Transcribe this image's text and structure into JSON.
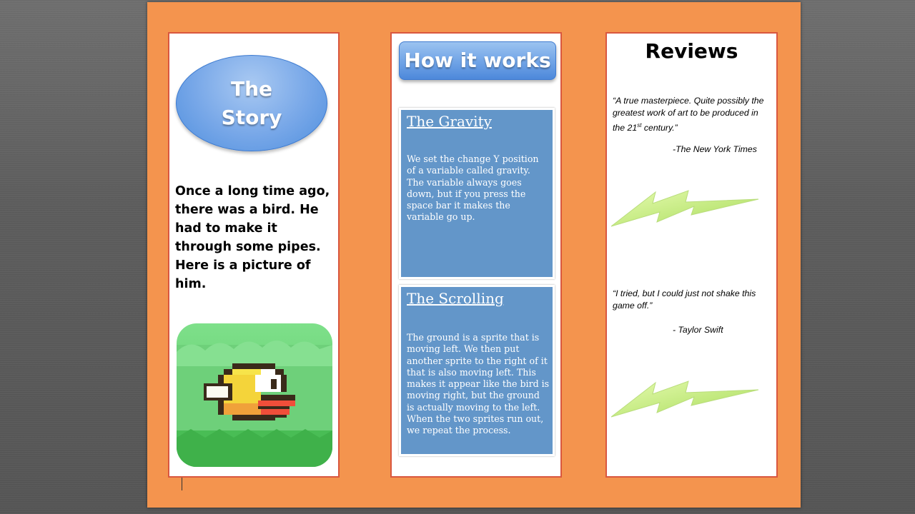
{
  "story": {
    "heading_line1": "The",
    "heading_line2": "Story",
    "text": "Once a long time ago, there was a bird. He had to make it through some pipes. Here is a picture of him.",
    "picture_icon": "flappy-bird-icon"
  },
  "how_it_works": {
    "title": "How it works",
    "sections": [
      {
        "title": "The Gravity",
        "body": "We set the change Y position of a variable called gravity. The variable always goes down, but if you press the space bar it makes the variable go up."
      },
      {
        "title": "The Scrolling",
        "body": "The ground is a sprite that is moving left. We then put another sprite to the right of it that is also moving left. This makes it appear like the bird is moving right, but the ground is actually moving to the left. When the two sprites run out, we repeat the process."
      }
    ]
  },
  "reviews": {
    "title": "Reviews",
    "items": [
      {
        "quote_pre": "“A true masterpiece. Quite possibly the greatest work of art to be produced in the 21",
        "quote_sup": "st",
        "quote_post": " century.”",
        "attribution": "-The New York Times"
      },
      {
        "quote_pre": "“I tried, but I could just not shake this game off.”",
        "quote_sup": "",
        "quote_post": "",
        "attribution": "- Taylor Swift"
      }
    ],
    "decoration_icon": "lightning-bolt-icon"
  },
  "colors": {
    "page_background": "#f4944e",
    "panel_border": "#d9573f",
    "blue_box": "#6396c9",
    "bolt": "#c9f27a"
  }
}
